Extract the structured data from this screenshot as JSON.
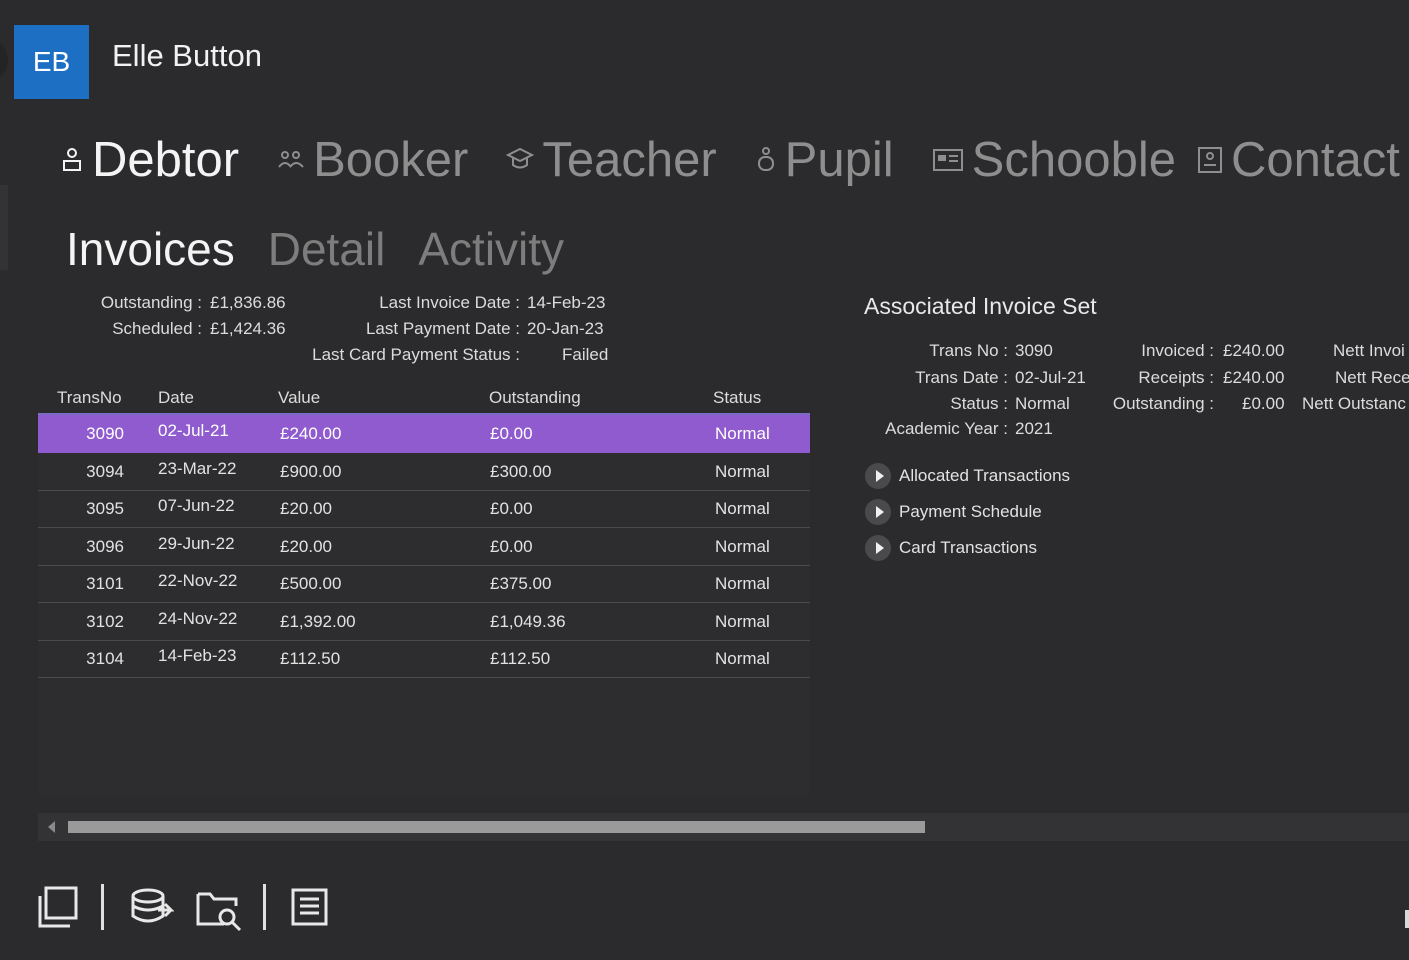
{
  "user": {
    "initials": "EB",
    "name": "Elle Button"
  },
  "main_tabs": [
    {
      "label": "Debtor",
      "icon": "person-icon",
      "active": true
    },
    {
      "label": "Booker",
      "icon": "group-icon",
      "active": false
    },
    {
      "label": "Teacher",
      "icon": "graduation-cap-icon",
      "active": false
    },
    {
      "label": "Pupil",
      "icon": "pupil-icon",
      "active": false
    },
    {
      "label": "Schooble",
      "icon": "id-card-icon",
      "active": false
    },
    {
      "label": "Contact",
      "icon": "contact-card-icon",
      "active": false
    }
  ],
  "sub_tabs": [
    {
      "label": "Invoices",
      "active": true
    },
    {
      "label": "Detail",
      "active": false
    },
    {
      "label": "Activity",
      "active": false
    }
  ],
  "summary": {
    "outstanding_label": "Outstanding :",
    "outstanding": "£1,836.86",
    "scheduled_label": "Scheduled :",
    "scheduled": "£1,424.36",
    "last_invoice_date_label": "Last Invoice Date :",
    "last_invoice_date": "14-Feb-23",
    "last_payment_date_label": "Last Payment Date :",
    "last_payment_date": "20-Jan-23",
    "last_card_status_label": "Last Card Payment Status :",
    "last_card_status": "Failed"
  },
  "table": {
    "columns": [
      "TransNo",
      "Date",
      "Value",
      "Outstanding",
      "Status"
    ],
    "rows": [
      [
        "3090",
        "02-Jul-21",
        "£240.00",
        "£0.00",
        "Normal"
      ],
      [
        "3094",
        "23-Mar-22",
        "£900.00",
        "£300.00",
        "Normal"
      ],
      [
        "3095",
        "07-Jun-22",
        "£20.00",
        "£0.00",
        "Normal"
      ],
      [
        "3096",
        "29-Jun-22",
        "£20.00",
        "£0.00",
        "Normal"
      ],
      [
        "3101",
        "22-Nov-22",
        "£500.00",
        "£375.00",
        "Normal"
      ],
      [
        "3102",
        "24-Nov-22",
        "£1,392.00",
        "£1,049.36",
        "Normal"
      ],
      [
        "3104",
        "14-Feb-23",
        "£112.50",
        "£112.50",
        "Normal"
      ]
    ],
    "selected_index": 0,
    "selected_color": "#8f5bcf"
  },
  "invoice_set": {
    "title": "Associated Invoice Set",
    "trans_no_label": "Trans No :",
    "trans_no": "3090",
    "trans_date_label": "Trans Date :",
    "trans_date": "02-Jul-21",
    "status_label": "Status :",
    "status": "Normal",
    "academic_year_label": "Academic Year :",
    "academic_year": "2021",
    "invoiced_label": "Invoiced :",
    "invoiced": "£240.00",
    "receipts_label": "Receipts :",
    "receipts": "£240.00",
    "outstanding_label": "Outstanding :",
    "outstanding": "£0.00",
    "nett_invoiced_label": "Nett Invoi",
    "nett_receipts_label": "Nett Rece",
    "nett_outstanding_label": "Nett Outstanc",
    "expanders": [
      "Allocated Transactions",
      "Payment Schedule",
      "Card Transactions"
    ]
  },
  "toolbar": {
    "icons": [
      "new-window-icon",
      "database-sync-icon",
      "folder-search-icon",
      "report-icon"
    ]
  }
}
